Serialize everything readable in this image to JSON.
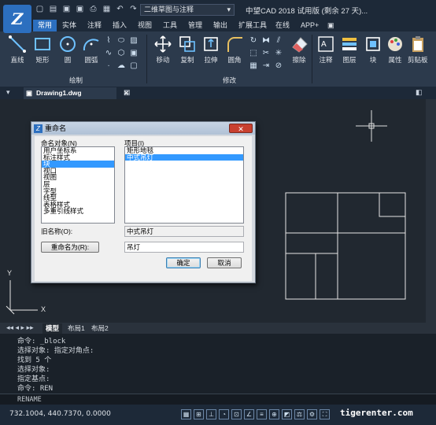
{
  "window": {
    "title": "中望CAD 2018 试用版 (剩余 27 天)...",
    "workspace": "二维草图与注释"
  },
  "menu_tabs": [
    "常用",
    "实体",
    "注释",
    "插入",
    "视图",
    "工具",
    "管理",
    "输出",
    "扩展工具",
    "在线",
    "APP+"
  ],
  "ribbon": {
    "draw_tools": [
      "直线",
      "矩形",
      "圆",
      "圆弧"
    ],
    "draw_group_label": "绘制",
    "modify_tools": [
      "移动",
      "复制",
      "拉伸",
      "圆角",
      "擦除"
    ],
    "modify_group_label": "修改",
    "right_tools": [
      "注释",
      "图层",
      "块",
      "属性",
      "剪贴板"
    ]
  },
  "document_tab": "Drawing1.dwg",
  "layout_tabs": [
    "模型",
    "布局1",
    "布局2"
  ],
  "ucs": {
    "y_label": "Y",
    "x_label": "X"
  },
  "dialog": {
    "title": "重命名",
    "named_objects_label": "命名对象(N)",
    "named_objects": [
      "用户坐标系",
      "标注样式",
      "块",
      "视口",
      "视图",
      "层",
      "字型",
      "线型",
      "表格样式",
      "多重引线样式"
    ],
    "named_objects_selected": "块",
    "items_label": "项目(I)",
    "items": [
      "矩形地毯",
      "中式吊灯"
    ],
    "items_selected": "中式吊灯",
    "old_name_label": "旧名称(O):",
    "old_name_value": "中式吊灯",
    "rename_button": "重命名为(R):",
    "new_name_value": "吊灯",
    "ok_button": "确定",
    "cancel_button": "取消",
    "close_button": "✕"
  },
  "command_history": [
    "命令: _block",
    "选择对象: 指定对角点:",
    "找到 5 个",
    "选择对象:",
    "指定基点:",
    "命令: REN"
  ],
  "command_input": "RENAME",
  "status": {
    "coordinates": "732.1004, 440.7370, 0.0000"
  },
  "watermark": "tigerenter.com"
}
